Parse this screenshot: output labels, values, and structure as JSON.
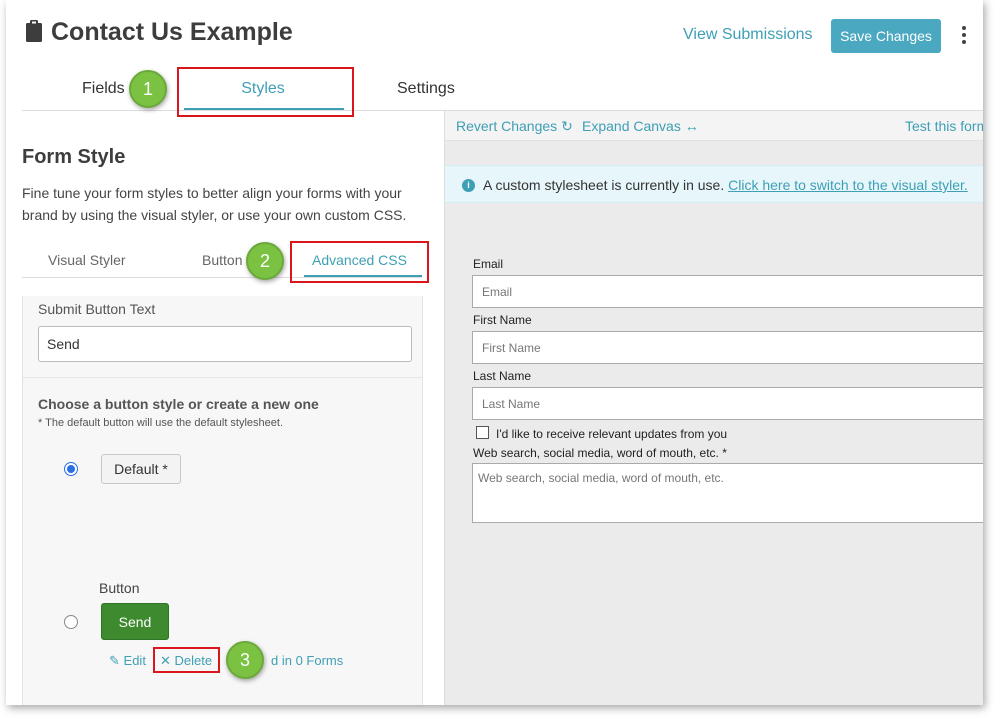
{
  "header": {
    "title": "Contact Us Example",
    "view_submissions": "View Submissions",
    "save_changes": "Save Changes"
  },
  "main_tabs": [
    {
      "label": "Fields"
    },
    {
      "label": "Styles",
      "active": true
    },
    {
      "label": "Settings"
    }
  ],
  "steps": [
    "1",
    "2",
    "3"
  ],
  "form_style": {
    "title": "Form Style",
    "description": "Fine tune your form styles to better align your forms with your brand by using the visual styler, or use your own custom CSS."
  },
  "sub_tabs": [
    {
      "label": "Visual Styler"
    },
    {
      "label": "Button"
    },
    {
      "label": "Advanced CSS",
      "active": true
    }
  ],
  "submit_button": {
    "label": "Submit Button Text",
    "value": "Send"
  },
  "button_style": {
    "title": "Choose a button style or create a new one",
    "note": "* The default button will use the default stylesheet.",
    "default_label": "Default *",
    "custom_caption": "Button",
    "custom_label": "Send",
    "edit": "Edit",
    "delete": "Delete",
    "usage": "d in 0 Forms"
  },
  "toolbar": {
    "revert": "Revert Changes",
    "expand": "Expand Canvas",
    "test": "Test this form"
  },
  "info": {
    "text": "A custom stylesheet is currently in use.",
    "link": "Click here to switch to the visual styler."
  },
  "preview_form": {
    "email_label": "Email",
    "email_placeholder": "Email",
    "first_label": "First Name",
    "first_placeholder": "First Name",
    "last_label": "Last Name",
    "last_placeholder": "Last Name",
    "checkbox_label": "I'd like to receive relevant updates from you",
    "source_label": "Web search, social media, word of mouth, etc. *",
    "source_placeholder": "Web search, social media, word of mouth, etc."
  },
  "colors": {
    "accent": "#3e9fb5",
    "save_button": "#4aa8c0",
    "send_button": "#3d8b2e",
    "highlight": "#d9161c",
    "step_badge": "#7bc142"
  }
}
